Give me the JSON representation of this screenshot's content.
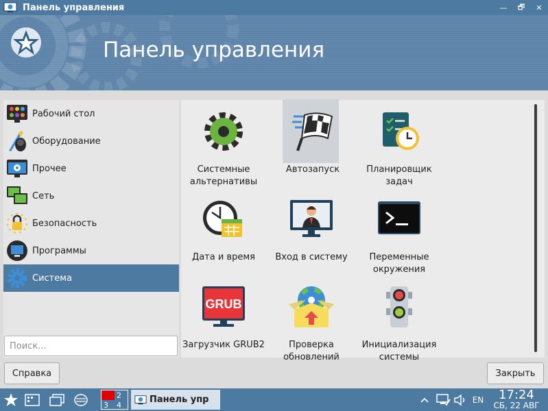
{
  "window": {
    "title": "Панель управления",
    "controls": [
      "—",
      "🗗",
      "✕"
    ]
  },
  "banner": {
    "title": "Панель управления"
  },
  "categories": [
    {
      "label": "Рабочий стол",
      "icon": "desktop-icon",
      "active": false
    },
    {
      "label": "Оборудование",
      "icon": "hardware-icon",
      "active": false
    },
    {
      "label": "Прочее",
      "icon": "other-icon",
      "active": false
    },
    {
      "label": "Сеть",
      "icon": "network-icon",
      "active": false
    },
    {
      "label": "Безопасность",
      "icon": "security-icon",
      "active": false
    },
    {
      "label": "Программы",
      "icon": "programs-icon",
      "active": false
    },
    {
      "label": "Система",
      "icon": "system-icon",
      "active": true
    }
  ],
  "search": {
    "placeholder": "Поиск..."
  },
  "apps": [
    {
      "label": "Системные\nальтернативы",
      "icon": "gear-icon"
    },
    {
      "label": "Автозапуск",
      "icon": "checkered-flag-icon",
      "selected": true
    },
    {
      "label": "Планировщик\nзадач",
      "icon": "scheduler-icon"
    },
    {
      "label": "Дата и время",
      "icon": "clock-calendar-icon"
    },
    {
      "label": "Вход в систему",
      "icon": "login-icon"
    },
    {
      "label": "Переменные\nокружения",
      "icon": "terminal-icon"
    },
    {
      "label": "Загрузчик GRUB2",
      "icon": "grub-icon"
    },
    {
      "label": "Проверка\nобновлений",
      "icon": "update-icon"
    },
    {
      "label": "Инициализация\nсистемы",
      "icon": "traffic-light-icon"
    }
  ],
  "grub_text": "GRUB",
  "buttons": {
    "help": "Справка",
    "close": "Закрыть"
  },
  "taskbar": {
    "pager": [
      "1",
      "2",
      "3",
      "4"
    ],
    "task_label": "Панель упр",
    "lang": "EN",
    "time": "17:24",
    "date": "СБ, 22 АВГ"
  },
  "colors": {
    "accent": "#4d7aa1",
    "banner": "#5e84a9",
    "selected": "#cfd3d8"
  }
}
